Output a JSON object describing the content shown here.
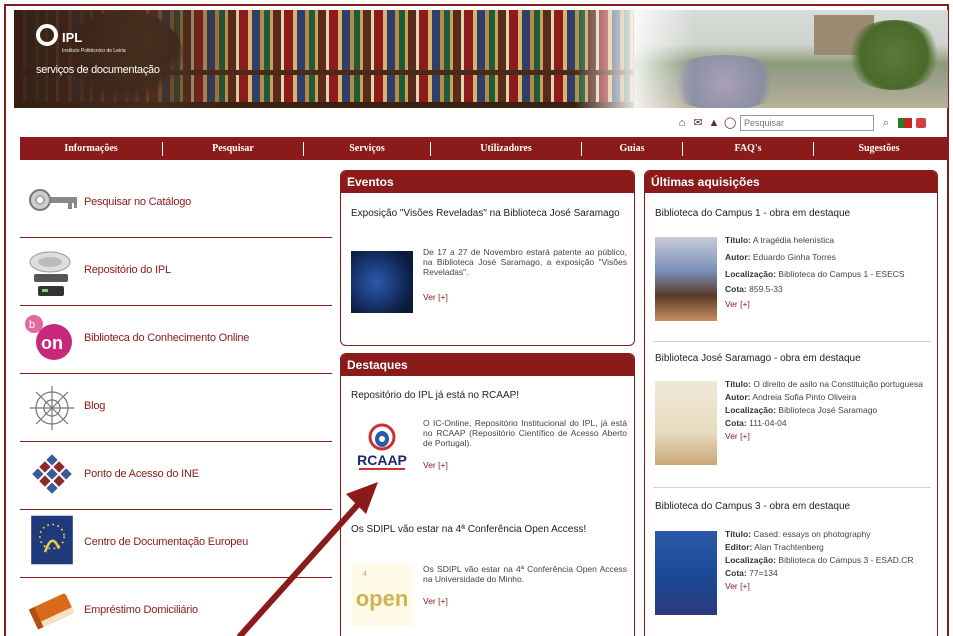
{
  "header": {
    "logo_text": "IPL",
    "logo_small": "Instituto Politécnico de Leiria",
    "logo_sub": "serviços de documentação"
  },
  "tools": {
    "icons": [
      "home-icon",
      "mail-icon",
      "sitemap-icon",
      "accessibility-icon"
    ],
    "search_placeholder": "Pesquisar",
    "search_button": "search-icon"
  },
  "nav": {
    "items": [
      "Informações",
      "Pesquisar",
      "Serviços",
      "Utilizadores",
      "Guias",
      "FAQ's",
      "Sugestões"
    ]
  },
  "left": {
    "items": [
      {
        "label": "Pesquisar no Catálogo",
        "icon": "key-icon"
      },
      {
        "label": "Repositório do IPL",
        "icon": "server-icon"
      },
      {
        "label": "Biblioteca do Conhecimento Online",
        "icon": "b-on-icon"
      },
      {
        "label": "Blog",
        "icon": "blog-icon"
      },
      {
        "label": "Ponto de Acesso do INE",
        "icon": "ine-icon"
      },
      {
        "label": "Centro de Documentação Europeu",
        "icon": "eu-icon"
      },
      {
        "label": "Empréstimo Domiciliário",
        "icon": "book-icon"
      }
    ]
  },
  "eventos": {
    "head": "Eventos",
    "title": "Exposição \"Visões Reveladas\" na Biblioteca José Saramago",
    "text": "De 17 a 27 de Novembro estará patente ao público, na Biblioteca José Saramago, a exposição \"Visões Reveladas\".",
    "more": "Ver [+]"
  },
  "destaques": {
    "head": "Destaques",
    "item1_title": "Repositório do IPL já está no RCAAP!",
    "item1_text": "O IC-Online, Repositório Institucional do IPL, já está no RCAAP (Repositório Científico de Acesso Aberto de Portugal).",
    "item1_logo": "RCAAP",
    "item1_more": "Ver [+]",
    "item2_title": "Os SDIPL vão estar na 4ª Conferência Open Access!",
    "item2_text": "Os SDIPL vão estar na 4ª Conferência Open Access na Universidade do Minho.",
    "item2_logo": "open",
    "item2_more": "Ver [+]"
  },
  "aquisicoes": {
    "head": "Últimas aquisições",
    "items": [
      {
        "title": "Biblioteca do Campus 1 - obra em destaque",
        "titulo_label": "Título:",
        "titulo": "A tragédia helenística",
        "autor_label": "Autor:",
        "autor": "Eduardo Ginha Torres",
        "loc_label": "Localização:",
        "loc": "Biblioteca do Campus 1 - ESECS",
        "cota_label": "Cota:",
        "cota": "859.5-33",
        "more": "Ver [+]"
      },
      {
        "title": "Biblioteca José Saramago - obra em destaque",
        "titulo_label": "Título:",
        "titulo": "O direito de asilo na Constituição portuguesa",
        "autor_label": "Autor:",
        "autor": "Andreia Sofia Pinto Oliveira",
        "loc_label": "Localização:",
        "loc": "Biblioteca José Saramago",
        "cota_label": "Cota:",
        "cota": "111-04-04",
        "more": "Ver [+]"
      },
      {
        "title": "Biblioteca do Campus 3 - obra em destaque",
        "titulo_label": "Título:",
        "titulo": "Cased: essays on photography",
        "autor_label": "Editor:",
        "autor": "Alan Trachtenberg",
        "loc_label": "Localização:",
        "loc": "Biblioteca do Campus 3 - ESAD.CR",
        "cota_label": "Cota:",
        "cota": "77=134",
        "more": "Ver [+]"
      }
    ]
  },
  "colors": {
    "brand": "#8b1a1a",
    "arrow": "#8b1a1a"
  }
}
